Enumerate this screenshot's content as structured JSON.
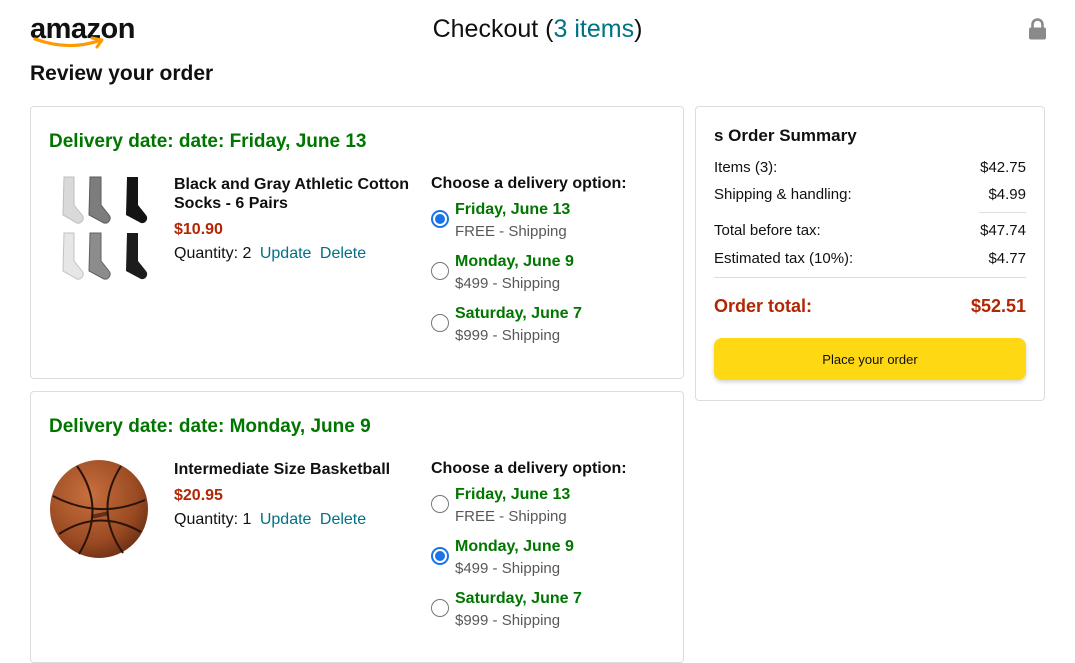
{
  "header": {
    "logo_text": "amazon",
    "checkout_label": "Checkout (",
    "item_count": "3 items",
    "checkout_close": ")"
  },
  "page_title": "Review your order",
  "orders": [
    {
      "delivery_date": "Delivery date: date: Friday, June 13",
      "product_name": "Black and Gray Athletic Cotton Socks - 6 Pairs",
      "price": "$10.90",
      "quantity_label": "Quantity:",
      "quantity": "2",
      "update_label": "Update",
      "delete_label": "Delete",
      "options_title": "Choose a delivery option:",
      "options": [
        {
          "date": "Friday, June 13",
          "shipping": "FREE - Shipping",
          "selected": true
        },
        {
          "date": "Monday, June 9",
          "shipping": "$499 - Shipping",
          "selected": false
        },
        {
          "date": "Saturday, June 7",
          "shipping": "$999 - Shipping",
          "selected": false
        }
      ]
    },
    {
      "delivery_date": "Delivery date: date: Monday, June 9",
      "product_name": "Intermediate Size Basketball",
      "price": "$20.95",
      "quantity_label": "Quantity:",
      "quantity": "1",
      "update_label": "Update",
      "delete_label": "Delete",
      "options_title": "Choose a delivery option:",
      "options": [
        {
          "date": "Friday, June 13",
          "shipping": "FREE - Shipping",
          "selected": false
        },
        {
          "date": "Monday, June 9",
          "shipping": "$499 - Shipping",
          "selected": true
        },
        {
          "date": "Saturday, June 7",
          "shipping": "$999 - Shipping",
          "selected": false
        }
      ]
    }
  ],
  "summary": {
    "title": "s Order Summary",
    "items_label": "Items (3):",
    "items_value": "$42.75",
    "shipping_label": "Shipping & handling:",
    "shipping_value": "$4.99",
    "before_tax_label": "Total before tax:",
    "before_tax_value": "$47.74",
    "tax_label": "Estimated tax (10%):",
    "tax_value": "$4.77",
    "total_label": "Order total:",
    "total_value": "$52.51",
    "place_order_label": "Place your order"
  },
  "colors": {
    "delivery_green": "#007600",
    "price_red": "#b12704",
    "link_teal": "#017185",
    "button_yellow": "#ffd814",
    "logo_orange": "#ff9900"
  },
  "icons": [
    "amazon-smile-icon",
    "lock-icon",
    "radio-icon"
  ]
}
